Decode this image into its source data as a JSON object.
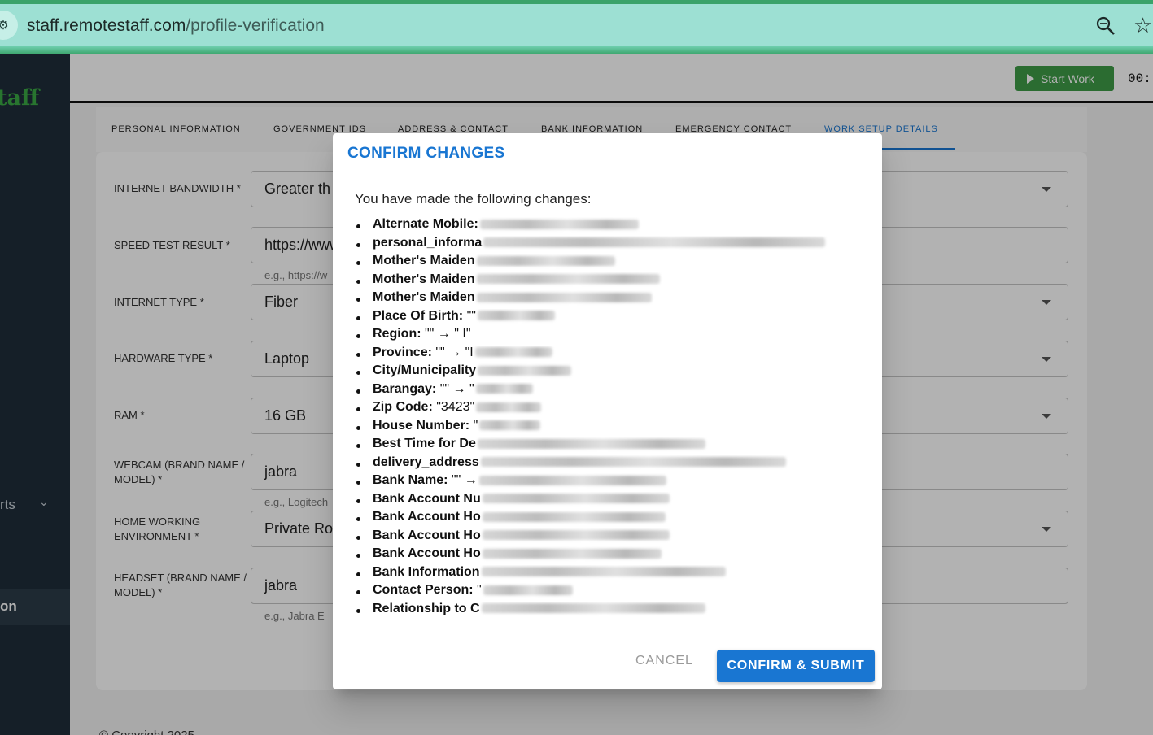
{
  "browser": {
    "url_domain": "staff.remotestaff.com",
    "url_path": "/profile-verification"
  },
  "sidebar": {
    "brand": "taff",
    "reports_label": "rts",
    "active_label": "on"
  },
  "appbar": {
    "start_work": "Start Work",
    "timer": "00:"
  },
  "tabs": [
    "PERSONAL INFORMATION",
    "GOVERNMENT IDS",
    "ADDRESS & CONTACT",
    "BANK INFORMATION",
    "EMERGENCY CONTACT",
    "WORK SETUP DETAILS"
  ],
  "form": {
    "internet_bandwidth": {
      "label": "INTERNET BANDWIDTH *",
      "value": "Greater th"
    },
    "speed_test": {
      "label": "SPEED TEST RESULT *",
      "value": "https://www",
      "helper": "e.g., https://w"
    },
    "internet_type": {
      "label": "INTERNET TYPE *",
      "value": "Fiber"
    },
    "hardware_type": {
      "label": "HARDWARE TYPE *",
      "value": "Laptop"
    },
    "ram": {
      "label": "RAM *",
      "value": "16 GB"
    },
    "webcam": {
      "label": "WEBCAM (BRAND NAME / MODEL) *",
      "value": "jabra",
      "helper": "e.g., Logitech"
    },
    "home_env": {
      "label": "HOME WORKING ENVIRONMENT *",
      "value": "Private Ro"
    },
    "headset": {
      "label": "HEADSET (BRAND NAME / MODEL) *",
      "value": "jabra",
      "helper": "e.g., Jabra E"
    }
  },
  "footer": {
    "copyright": "© Copyright 2025"
  },
  "dialog": {
    "title": "CONFIRM CHANGES",
    "intro": "You have made the following changes:",
    "changes": [
      {
        "field": "Alternate Mobile:",
        "text": ""
      },
      {
        "field": "personal_informa",
        "text": ""
      },
      {
        "field": "Mother's Maiden",
        "text": ""
      },
      {
        "field": "Mother's Maiden",
        "text": ""
      },
      {
        "field": "Mother's Maiden",
        "text": ""
      },
      {
        "field": "Place Of Birth:",
        "text": " \"\""
      },
      {
        "field": "Region:",
        "text": " \"\" → \" I\""
      },
      {
        "field": "Province:",
        "text": " \"\" → \"I"
      },
      {
        "field": "City/Municipality",
        "text": ""
      },
      {
        "field": "Barangay:",
        "text": " \"\" → \""
      },
      {
        "field": "Zip Code:",
        "text": " \"3423\""
      },
      {
        "field": "House Number:",
        "text": " \""
      },
      {
        "field": "Best Time for De",
        "text": ""
      },
      {
        "field": "delivery_address",
        "text": ""
      },
      {
        "field": "Bank Name:",
        "text": " \"\" →"
      },
      {
        "field": "Bank Account Nu",
        "text": ""
      },
      {
        "field": "Bank Account Ho",
        "text": ""
      },
      {
        "field": "Bank Account Ho",
        "text": ""
      },
      {
        "field": "Bank Account Ho",
        "text": ""
      },
      {
        "field": "Bank Information",
        "text": ""
      },
      {
        "field": "Contact Person:",
        "text": " \""
      },
      {
        "field": "Relationship to C",
        "text": ""
      }
    ],
    "cancel": "CANCEL",
    "confirm": "CONFIRM & SUBMIT"
  }
}
